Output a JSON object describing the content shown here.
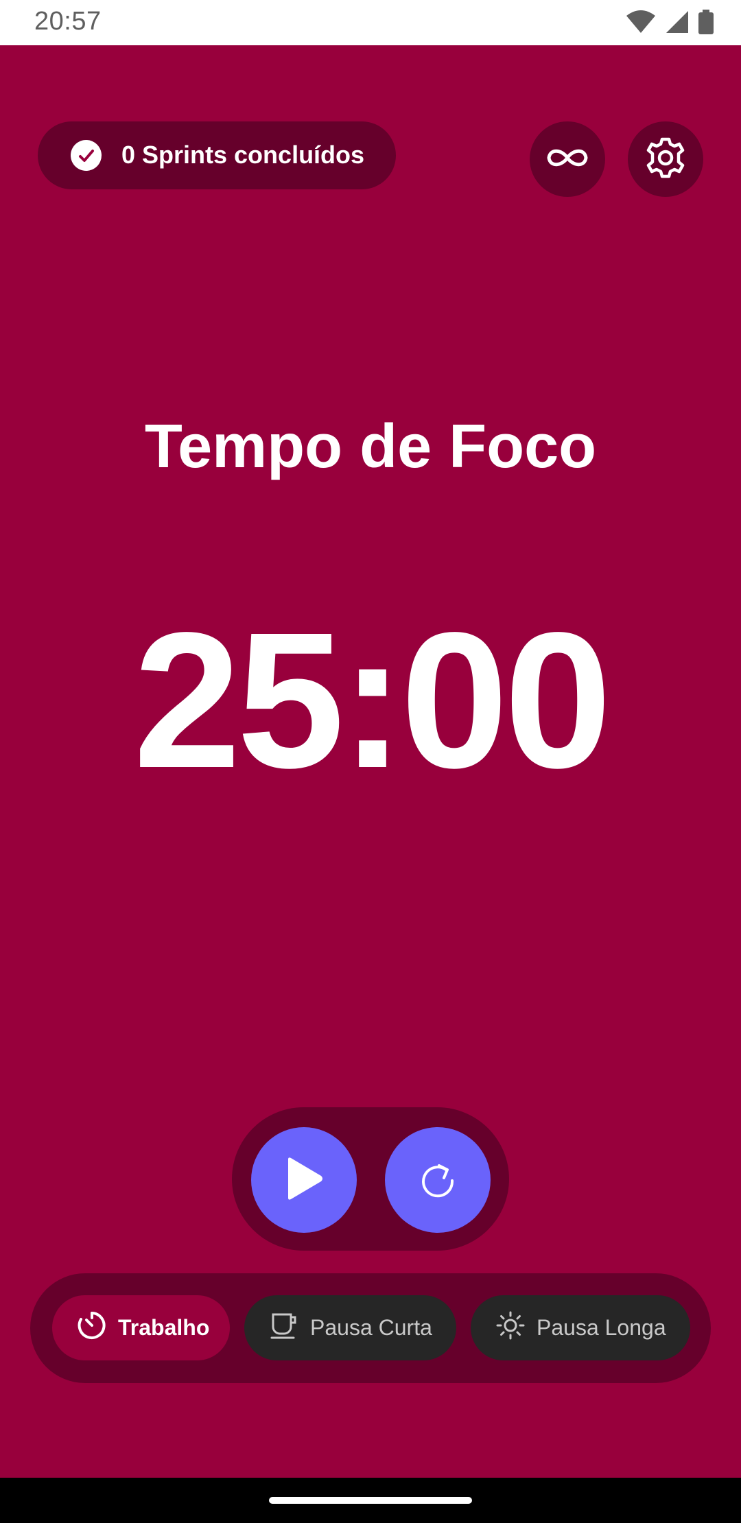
{
  "status_bar": {
    "time": "20:57",
    "icons": [
      "wifi-icon",
      "signal-icon",
      "battery-icon"
    ]
  },
  "header": {
    "sprints_label": "0 Sprints concluídos",
    "check_icon": "check-icon",
    "infinite_icon": "infinity-icon",
    "settings_icon": "gear-icon"
  },
  "main": {
    "mode_title": "Tempo de Foco",
    "timer": "25:00"
  },
  "controls": {
    "play_icon": "play-icon",
    "reset_icon": "reset-icon"
  },
  "modes": [
    {
      "label": "Trabalho",
      "icon": "timer-icon",
      "selected": true
    },
    {
      "label": "Pausa Curta",
      "icon": "coffee-cup-icon",
      "selected": false
    },
    {
      "label": "Pausa Longa",
      "icon": "sun-icon",
      "selected": false
    }
  ],
  "colors": {
    "background": "#98003c",
    "dark_accent": "#66002b",
    "action": "#6a63fb",
    "chip_inactive": "#262626"
  }
}
